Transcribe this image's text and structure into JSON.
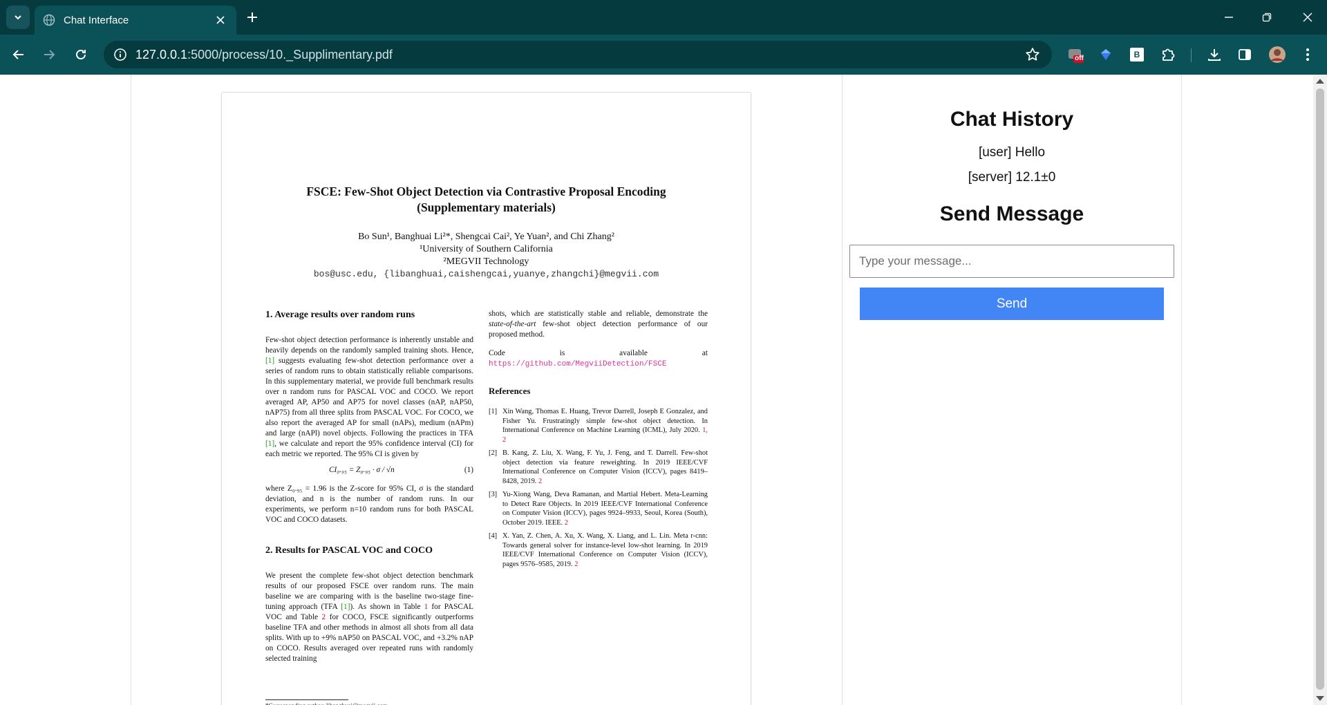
{
  "browser": {
    "tab_title": "Chat Interface",
    "url_host": "127.0.0.1",
    "url_rest": ":5000/process/10._Supplimentary.pdf",
    "ext_badge": "off",
    "ext_b_label": "B"
  },
  "pdf": {
    "title_line1": "FSCE: Few-Shot Object Detection via Contrastive Proposal Encoding",
    "title_line2": "(Supplementary materials)",
    "authors": "Bo Sun¹, Banghuai Li²*, Shengcai Cai², Ye Yuan², and Chi Zhang²",
    "affil1": "¹University of Southern California",
    "affil2": "²MEGVII Technology",
    "emails": "bos@usc.edu, {libanghuai,caishengcai,yuanye,zhangchi}@megvii.com",
    "sec1_heading": "1. Average results over random runs",
    "sec1_p1_a": "Few-shot object detection performance is inherently unstable and heavily depends on the randomly sampled training shots. Hence, ",
    "sec1_p1_ref": "[1]",
    "sec1_p1_b": " suggests evaluating few-shot detection performance over a series of random runs to obtain statistically reliable comparisons. In this supplementary material, we provide full benchmark results over n random runs for PASCAL VOC and COCO. We report averaged AP, AP50 and AP75 for novel classes (nAP, nAP50, nAP75) from all three splits from PASCAL VOC. For COCO, we also report the averaged AP for small (nAPs), medium (nAPm) and large (nAPl) novel objects. Following the practices in TFA ",
    "sec1_p1_ref2": "[1]",
    "sec1_p1_c": ", we calculate and report the 95% confidence interval (CI) for each metric we reported. The 95% CI is given by",
    "equation": "CI₀.₉₅ = Z₀.₉₅ · σ / √n",
    "equation_num": "(1)",
    "sec1_p2": "where Z₀.₉₅ = 1.96 is the Z-score for 95% CI, σ is the standard deviation, and n is the number of random runs. In our experiments, we perform n=10 random runs for both PASCAL VOC and COCO datasets.",
    "sec2_heading": "2. Results for PASCAL VOC and COCO",
    "sec2_p1_a": "We present the complete few-shot object detection benchmark results of our proposed FSCE over random runs. The main baseline we are comparing with is the baseline two-stage fine-tuning approach (TFA ",
    "sec2_p1_ref": "[1]",
    "sec2_p1_b": "). As shown in Table ",
    "sec2_p1_t1": "1",
    "sec2_p1_c": " for PASCAL VOC and Table ",
    "sec2_p1_t2": "2",
    "sec2_p1_d": " for COCO, FSCE significantly outperforms baseline TFA and other methods in almost all shots from all data splits. With up to +9% nAP50 on PASCAL VOC, and +3.2% nAP on COCO. Results averaged over repeated runs with randomly selected training",
    "right_p1_a": "shots, which are statistically stable and reliable, demonstrate the ",
    "right_p1_em": "state-of-the-art",
    "right_p1_b": " few-shot object detection performance of our proposed method.",
    "code_text": "Code is available at ",
    "code_url": "https://github.com/MegviiDetection/FSCE",
    "refs_heading": "References",
    "refs": [
      {
        "n": "[1]",
        "text": "Xin Wang, Thomas E. Huang, Trevor Darrell, Joseph E Gonzalez, and Fisher Yu. Frustratingly simple few-shot object detection. In International Conference on Machine Learning (ICML), July 2020.",
        "back": "1, 2"
      },
      {
        "n": "[2]",
        "text": "B. Kang, Z. Liu, X. Wang, F. Yu, J. Feng, and T. Darrell. Few-shot object detection via feature reweighting. In 2019 IEEE/CVF International Conference on Computer Vision (ICCV), pages 8419–8428, 2019.",
        "back": "2"
      },
      {
        "n": "[3]",
        "text": "Yu-Xiong Wang, Deva Ramanan, and Martial Hebert. Meta-Learning to Detect Rare Objects. In 2019 IEEE/CVF International Conference on Computer Vision (ICCV), pages 9924–9933, Seoul, Korea (South), October 2019. IEEE.",
        "back": "2"
      },
      {
        "n": "[4]",
        "text": "X. Yan, Z. Chen, A. Xu, X. Wang, X. Liang, and L. Lin. Meta r-cnn: Towards general solver for instance-level low-shot learning. In 2019 IEEE/CVF International Conference on Computer Vision (ICCV), pages 9576–9585, 2019.",
        "back": "2"
      }
    ],
    "footnote": "*Corresponding author: libanghuai@megvii.com"
  },
  "chat": {
    "history_title": "Chat History",
    "messages": [
      "[user] Hello",
      "[server] 12.1±0"
    ],
    "send_title": "Send Message",
    "input_placeholder": "Type your message...",
    "input_value": "",
    "send_label": "Send"
  },
  "colors": {
    "chrome_dark": "#053a3f",
    "chrome_toolbar": "#0b5158",
    "send_button": "#4285f4",
    "pdf_link_red": "#d0102a",
    "pdf_link_green": "#17a017",
    "pdf_url_pink": "#e0309a"
  }
}
